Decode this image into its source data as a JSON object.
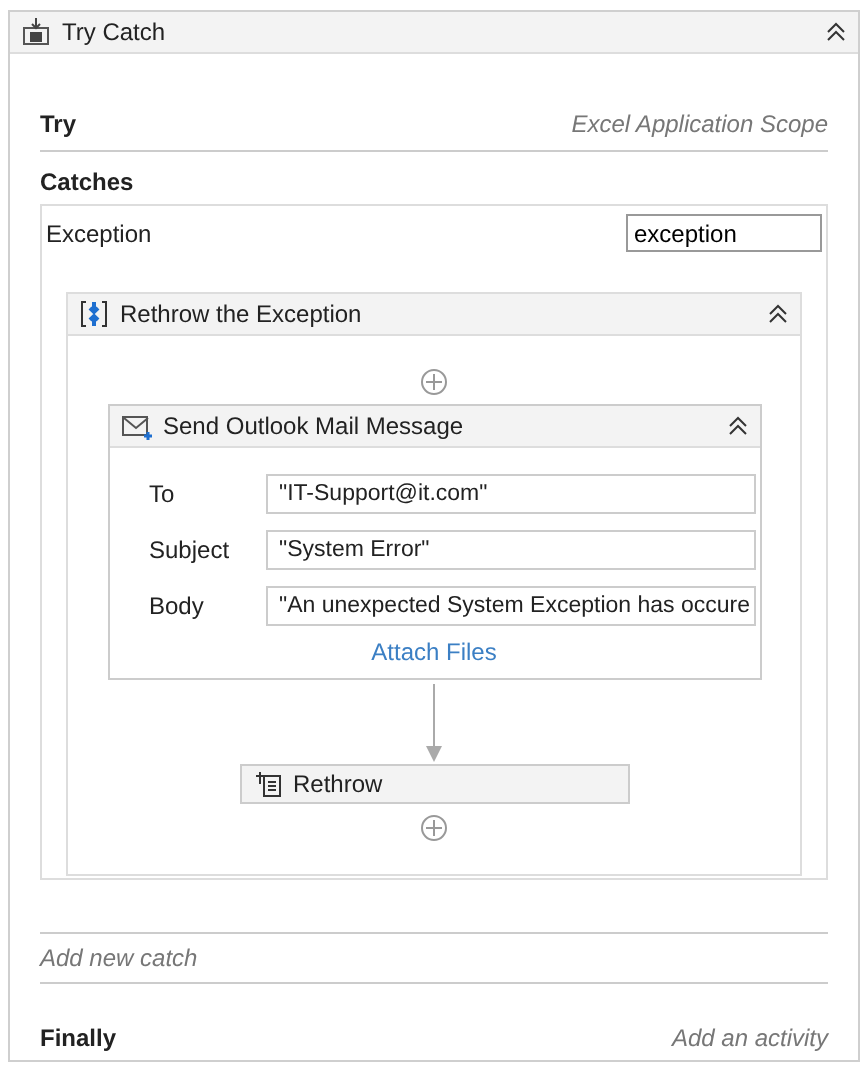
{
  "activity": {
    "title": "Try Catch"
  },
  "try": {
    "label": "Try",
    "placeholder": "Excel Application Scope"
  },
  "catches": {
    "label": "Catches",
    "exception_label": "Exception",
    "exception_value": "exception",
    "sequence": {
      "title": "Rethrow the Exception",
      "mail": {
        "title": "Send Outlook Mail Message",
        "fields": [
          {
            "label": "To",
            "value": "\"IT-Support@it.com\""
          },
          {
            "label": "Subject",
            "value": "\"System Error\""
          },
          {
            "label": "Body",
            "value": "\"An unexpected System Exception has occure"
          }
        ],
        "link": "Attach Files"
      },
      "rethrow": "Rethrow"
    },
    "add_catch": "Add new catch"
  },
  "finally": {
    "label": "Finally",
    "placeholder": "Add an activity"
  }
}
